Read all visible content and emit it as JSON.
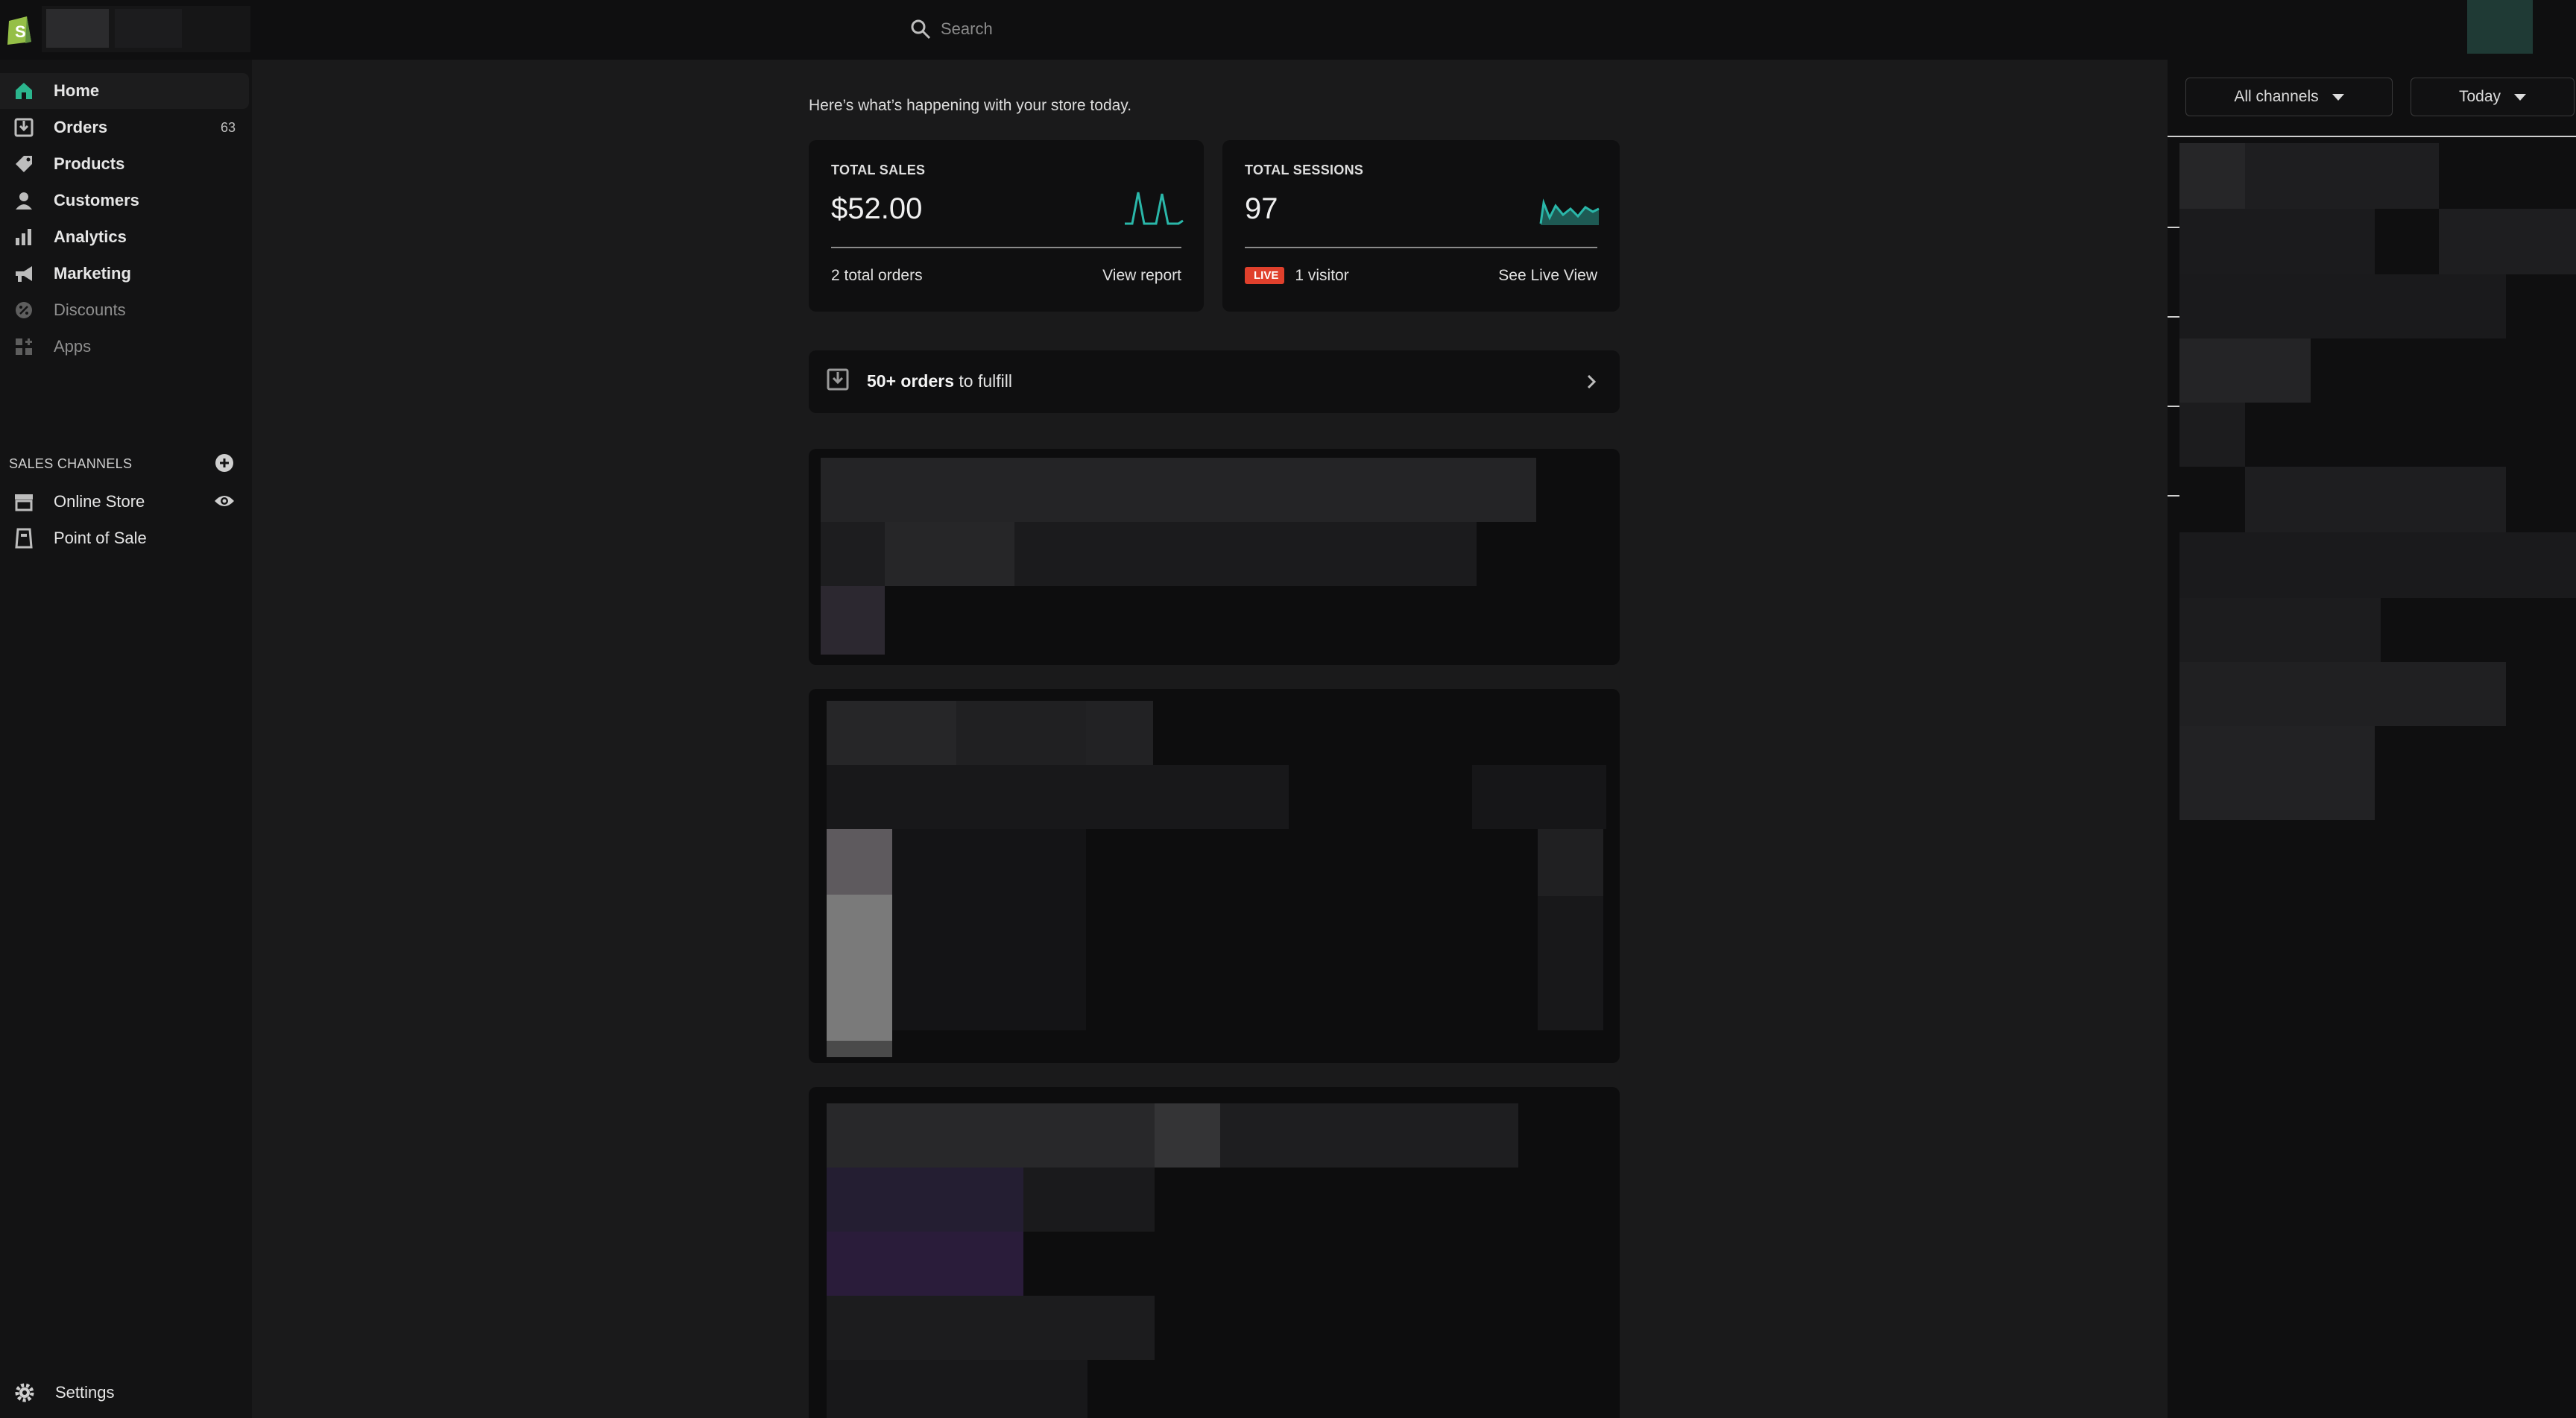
{
  "search": {
    "placeholder": "Search"
  },
  "sidebar": {
    "items": [
      {
        "label": "Home",
        "icon": "home-icon"
      },
      {
        "label": "Orders",
        "icon": "orders-icon",
        "badge": "63"
      },
      {
        "label": "Products",
        "icon": "tag-icon"
      },
      {
        "label": "Customers",
        "icon": "person-icon"
      },
      {
        "label": "Analytics",
        "icon": "bar-chart-icon"
      },
      {
        "label": "Marketing",
        "icon": "megaphone-icon"
      },
      {
        "label": "Discounts",
        "icon": "discount-icon"
      },
      {
        "label": "Apps",
        "icon": "apps-icon"
      }
    ],
    "sales_channels_title": "SALES CHANNELS",
    "channels": [
      {
        "label": "Online Store",
        "icon": "store-icon"
      },
      {
        "label": "Point of Sale",
        "icon": "pos-icon"
      }
    ],
    "settings_label": "Settings"
  },
  "main": {
    "intro": "Here’s what’s happening with your store today.",
    "total_sales": {
      "title": "TOTAL SALES",
      "value": "$52.00",
      "footer_left": "2 total orders",
      "footer_right": "View report"
    },
    "total_sessions": {
      "title": "TOTAL SESSIONS",
      "value": "97",
      "live_label": "LIVE",
      "footer_left": "1 visitor",
      "footer_right": "See Live View"
    },
    "fulfill": {
      "bold": "50+ orders",
      "rest": " to fulfill"
    }
  },
  "right_panel": {
    "channel_select": "All channels",
    "date_select": "Today"
  },
  "colors": {
    "accent_teal": "#2ab7a9",
    "live_red": "#e0402c",
    "shopify_green": "#95bf47"
  }
}
